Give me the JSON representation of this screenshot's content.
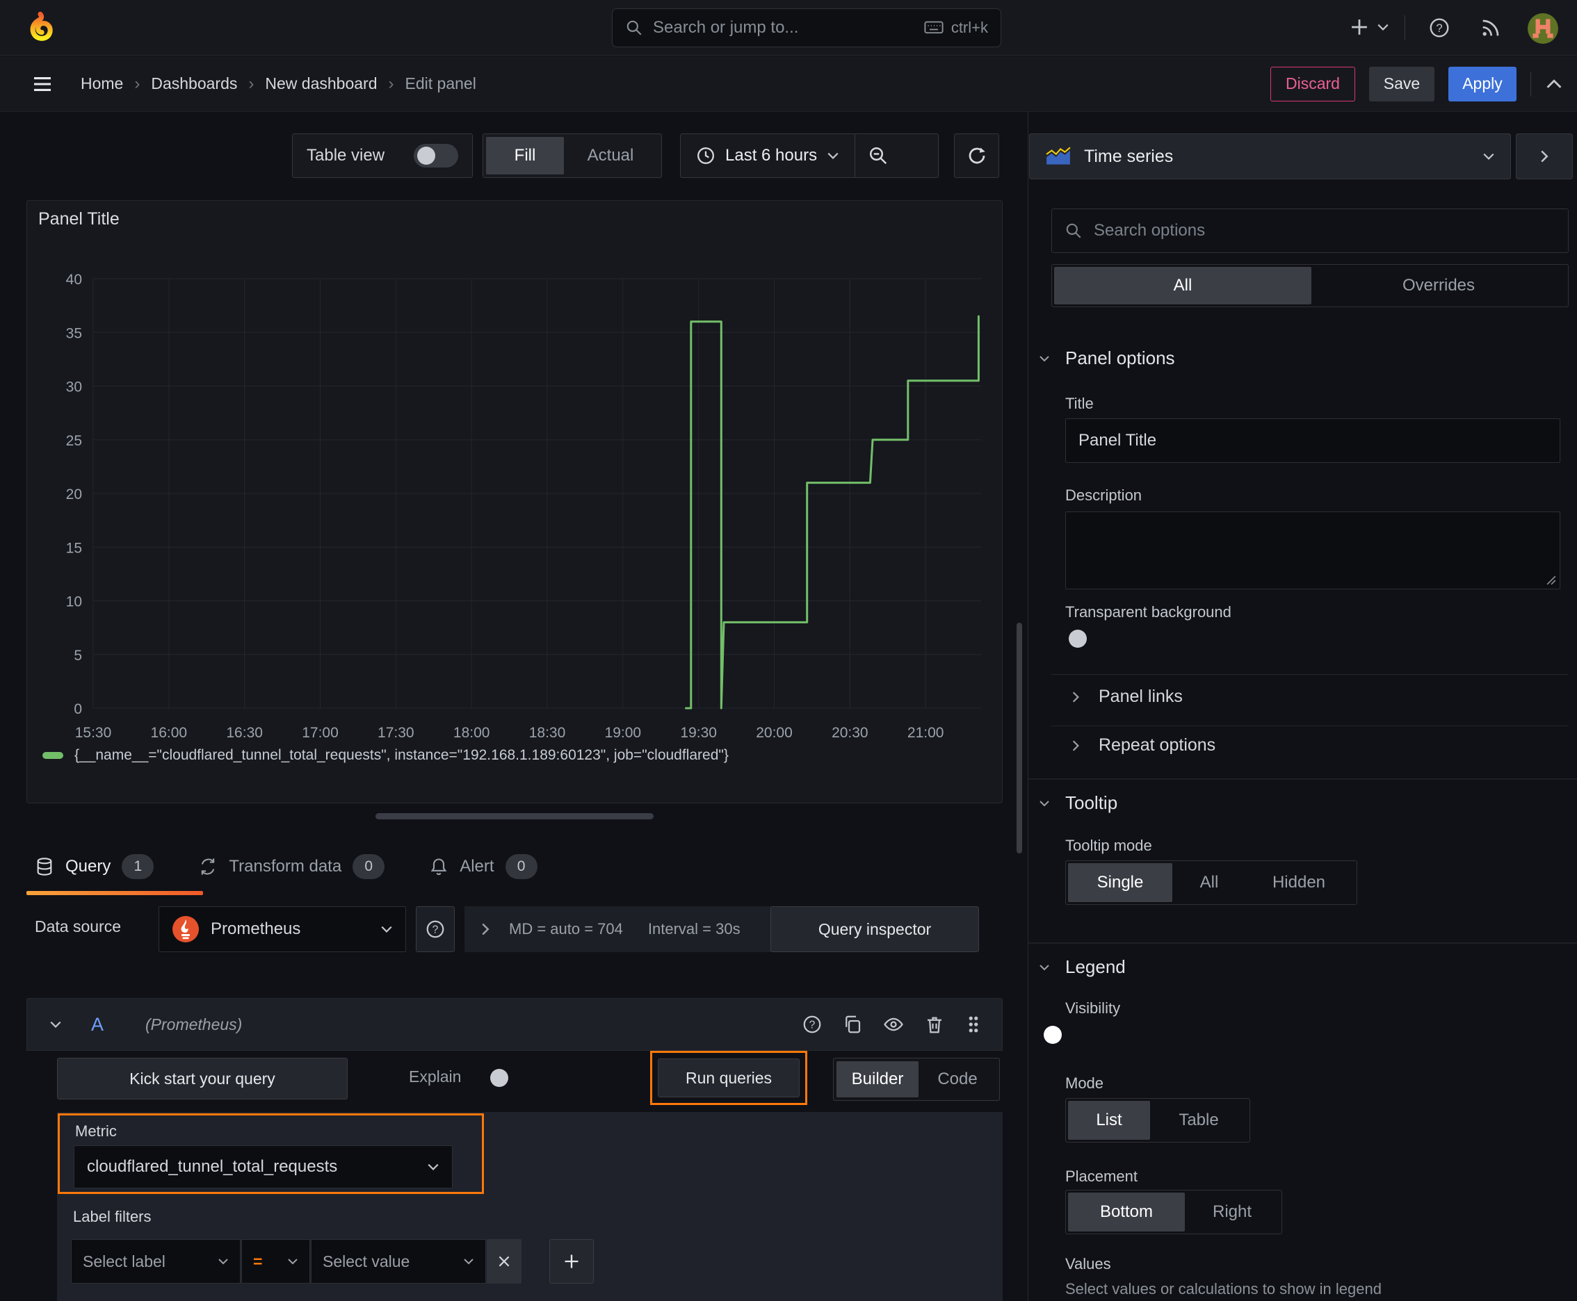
{
  "topbar": {
    "search_placeholder": "Search or jump to...",
    "search_shortcut": "ctrl+k"
  },
  "breadcrumb": {
    "items": [
      "Home",
      "Dashboards",
      "New dashboard"
    ],
    "current": "Edit panel",
    "separator": "›",
    "discard": "Discard",
    "save": "Save",
    "apply": "Apply"
  },
  "toolbar": {
    "table_view": "Table view",
    "fill": "Fill",
    "actual": "Actual",
    "time_range": "Last 6 hours"
  },
  "panel": {
    "title": "Panel Title",
    "legend": "{__name__=\"cloudflared_tunnel_total_requests\", instance=\"192.168.1.189:60123\", job=\"cloudflared\"}"
  },
  "chart_data": {
    "type": "line",
    "title": "Panel Title",
    "x_ticks": [
      "15:30",
      "16:00",
      "16:30",
      "17:00",
      "17:30",
      "18:00",
      "18:30",
      "19:00",
      "19:30",
      "20:00",
      "20:30",
      "21:00"
    ],
    "x_range_minutes": [
      930,
      1282
    ],
    "y_ticks": [
      0,
      5,
      10,
      15,
      20,
      25,
      30,
      35,
      40
    ],
    "ylim": [
      0,
      40
    ],
    "grid": true,
    "legend_position": "bottom",
    "series": [
      {
        "name": "{__name__=\"cloudflared_tunnel_total_requests\", instance=\"192.168.1.189:60123\", job=\"cloudflared\"}",
        "color": "#73bf69",
        "step_points": [
          [
            1165,
            0
          ],
          [
            1167,
            0
          ],
          [
            1167,
            36
          ],
          [
            1179,
            36
          ],
          [
            1179,
            0
          ],
          [
            1180,
            8
          ],
          [
            1213,
            8
          ],
          [
            1213,
            21
          ],
          [
            1238,
            21
          ],
          [
            1239,
            25
          ],
          [
            1253,
            25
          ],
          [
            1253,
            30.5
          ],
          [
            1281,
            30.5
          ],
          [
            1281,
            36.5
          ]
        ]
      }
    ]
  },
  "tabs": {
    "query": "Query",
    "query_count": "1",
    "transform": "Transform data",
    "transform_count": "0",
    "alert": "Alert",
    "alert_count": "0"
  },
  "datasource": {
    "label": "Data source",
    "name": "Prometheus",
    "stats_md": "MD = auto = 704",
    "stats_interval": "Interval = 30s",
    "inspector": "Query inspector"
  },
  "query_editor": {
    "ref": "A",
    "ds_hint": "(Prometheus)",
    "kickstart": "Kick start your query",
    "explain": "Explain",
    "run": "Run queries",
    "builder": "Builder",
    "code": "Code",
    "metric_label": "Metric",
    "metric_value": "cloudflared_tunnel_total_requests",
    "label_filters": "Label filters",
    "select_label": "Select label",
    "operator": "=",
    "select_value": "Select value"
  },
  "sidebar": {
    "viz": "Time series",
    "search_placeholder": "Search options",
    "tab_all": "All",
    "tab_overrides": "Overrides",
    "panel_options": {
      "header": "Panel options",
      "title_label": "Title",
      "title_value": "Panel Title",
      "description_label": "Description",
      "transparent_label": "Transparent background"
    },
    "panel_links": "Panel links",
    "repeat_options": "Repeat options",
    "tooltip": {
      "header": "Tooltip",
      "mode_label": "Tooltip mode",
      "options": [
        "Single",
        "All",
        "Hidden"
      ]
    },
    "legend": {
      "header": "Legend",
      "visibility": "Visibility",
      "mode_label": "Mode",
      "mode_options": [
        "List",
        "Table"
      ],
      "placement_label": "Placement",
      "placement_options": [
        "Bottom",
        "Right"
      ],
      "values_label": "Values",
      "values_help": "Select values or calculations to show in legend"
    }
  },
  "icons": {
    "grafana_logo": "flame-spiral",
    "search": "magnifier",
    "keyboard": "keyboard",
    "add": "plus",
    "help": "question-circle",
    "news": "rss",
    "avatar": "pixel-avatar",
    "menu": "hamburger",
    "clock": "clock",
    "zoom_out": "magnifier-minus",
    "refresh": "circular-arrow",
    "db": "database-cylinder",
    "transform": "cycle-arrows",
    "alert": "bell",
    "copy": "duplicate",
    "eye": "eye",
    "trash": "trash-can",
    "grip": "drag-dots",
    "timeseries": "mini-area-chart",
    "prometheus": "orange-flame",
    "close": "x-cross"
  },
  "colors": {
    "accent_orange": "#ff780a",
    "series_green": "#73bf69",
    "apply_blue": "#3d71d9",
    "discard_pink": "#ec5f96",
    "toggle_on_blue": "#3871dc"
  }
}
